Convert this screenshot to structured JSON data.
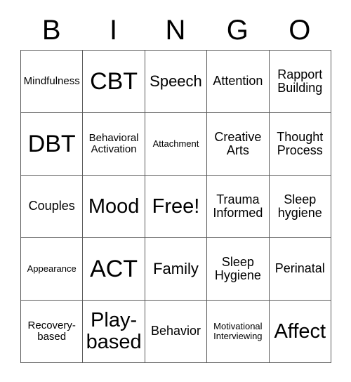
{
  "card": {
    "header": {
      "letters": [
        "B",
        "I",
        "N",
        "G",
        "O"
      ]
    },
    "colors": {
      "border": "#5a5a5a",
      "text": "#000000",
      "background": "#ffffff"
    },
    "rows": [
      [
        {
          "label": "Mindfulness",
          "size": "sm"
        },
        {
          "label": "CBT",
          "size": "xxl"
        },
        {
          "label": "Speech",
          "size": "lg"
        },
        {
          "label": "Attention",
          "size": "md"
        },
        {
          "label": "Rapport Building",
          "size": "md"
        }
      ],
      [
        {
          "label": "DBT",
          "size": "xxl"
        },
        {
          "label": "Behavioral Activation",
          "size": "sm"
        },
        {
          "label": "Attachment",
          "size": "xs"
        },
        {
          "label": "Creative Arts",
          "size": "md"
        },
        {
          "label": "Thought Process",
          "size": "md"
        }
      ],
      [
        {
          "label": "Couples",
          "size": "md"
        },
        {
          "label": "Mood",
          "size": "xl"
        },
        {
          "label": "Free!",
          "size": "xl"
        },
        {
          "label": "Trauma Informed",
          "size": "md"
        },
        {
          "label": "Sleep hygiene",
          "size": "md"
        }
      ],
      [
        {
          "label": "Appearance",
          "size": "xs"
        },
        {
          "label": "ACT",
          "size": "xxl"
        },
        {
          "label": "Family",
          "size": "lg"
        },
        {
          "label": "Sleep Hygiene",
          "size": "md"
        },
        {
          "label": "Perinatal",
          "size": "md"
        }
      ],
      [
        {
          "label": "Recovery-based",
          "size": "sm"
        },
        {
          "label": "Play-based",
          "size": "xl"
        },
        {
          "label": "Behavior",
          "size": "md"
        },
        {
          "label": "Motivational Interviewing",
          "size": "xs"
        },
        {
          "label": "Affect",
          "size": "xl"
        }
      ]
    ]
  }
}
